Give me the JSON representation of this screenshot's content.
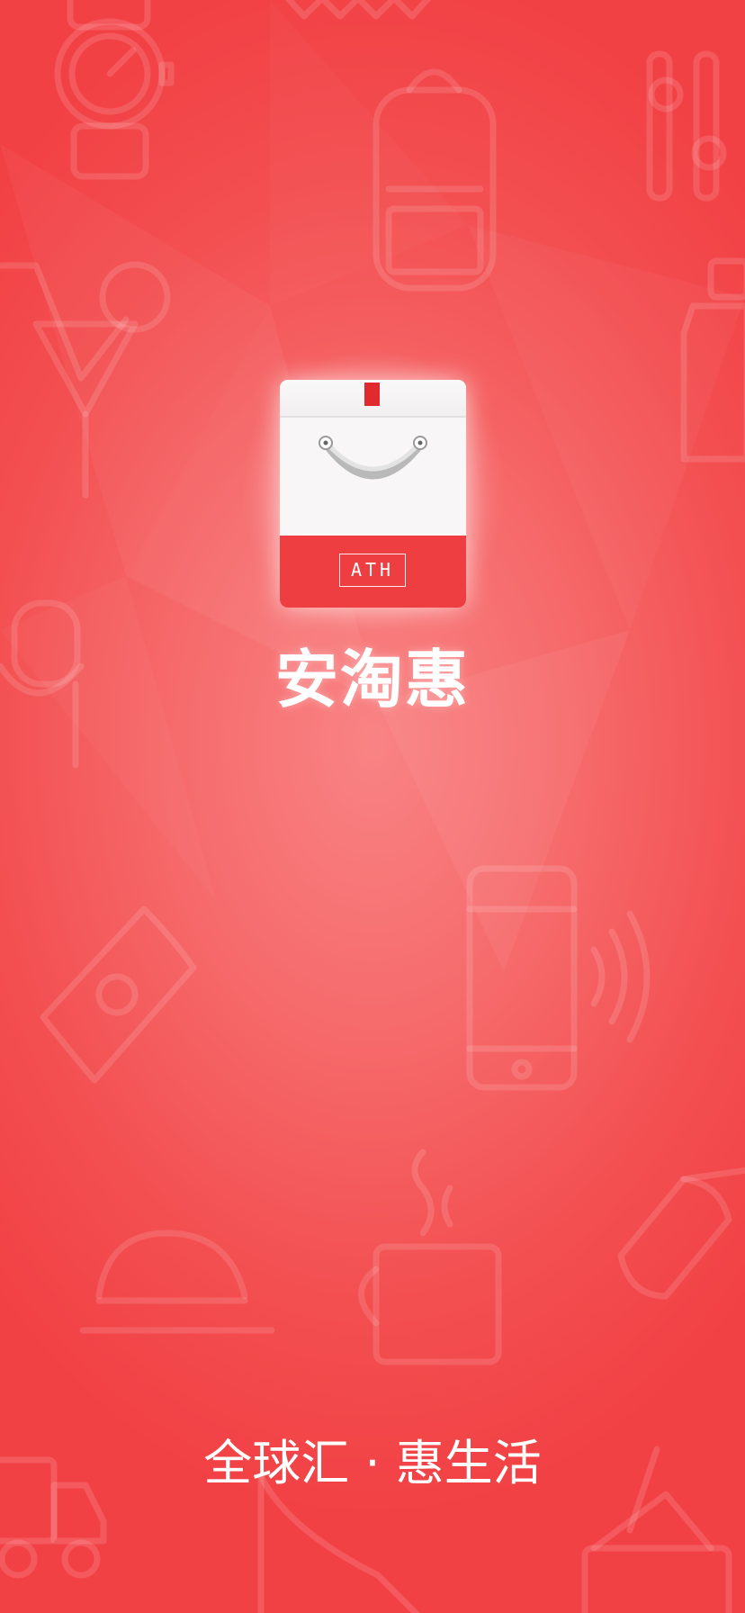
{
  "splash": {
    "app_name": "安淘惠",
    "logo_badge_text": "ATH",
    "slogan": "全球汇 · 惠生活"
  },
  "colors": {
    "background_center": "#f98384",
    "background_edge": "#f24145",
    "logo_red": "#ef3e42",
    "logo_tag": "#e12a30",
    "logo_white": "#f8f6f6",
    "text": "#ffffff"
  },
  "background_icons": [
    "watch-icon",
    "backpack-icon",
    "fork-spoon-icon",
    "cocktail-icon",
    "bottle-icon",
    "microphone-icon",
    "money-bill-icon",
    "smartphone-icon",
    "signal-waves-icon",
    "hard-hat-icon",
    "coffee-mug-icon",
    "sunglasses-icon",
    "delivery-truck-icon",
    "high-heel-icon",
    "shopping-basket-icon",
    "crown-icon"
  ]
}
